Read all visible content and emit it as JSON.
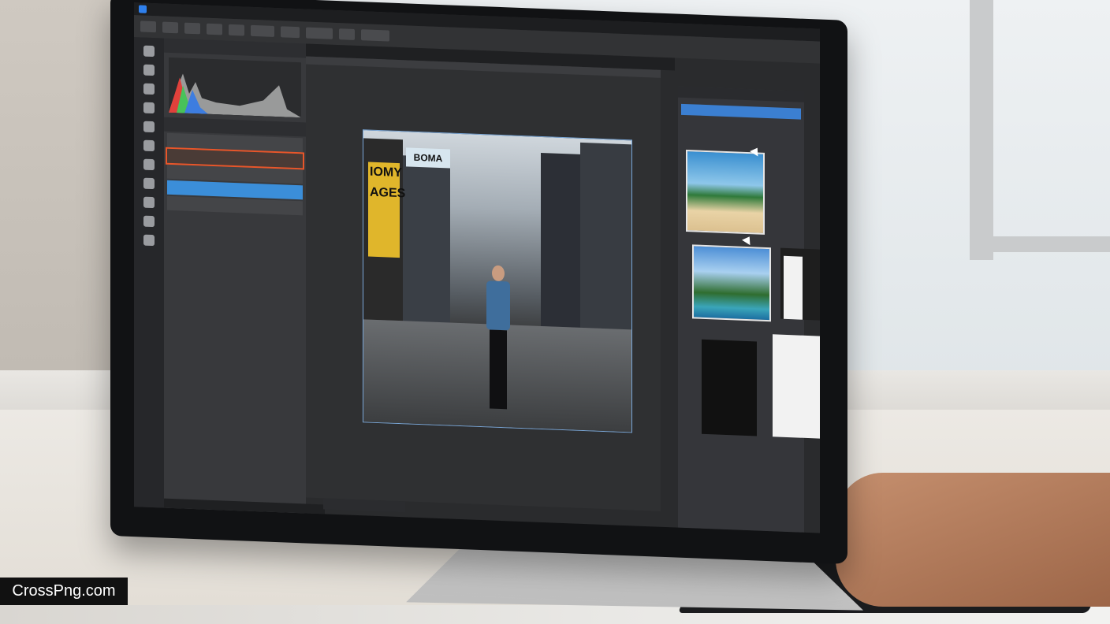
{
  "watermark": "CrossPng.com",
  "app": {
    "menu": [
      "",
      "",
      "",
      "",
      ""
    ],
    "document_tab": "",
    "panels": {
      "left_tabs": [
        "",
        ""
      ],
      "layers": [
        {
          "label": "",
          "state": "normal"
        },
        {
          "label": "",
          "state": "highlighted"
        },
        {
          "label": "",
          "state": "normal"
        },
        {
          "label": "",
          "state": "selected"
        },
        {
          "label": "",
          "state": "normal"
        }
      ],
      "right_tabs": [
        "",
        ""
      ],
      "status_left": "",
      "status_right": ""
    }
  },
  "colors": {
    "accent_blue": "#3b8ed9",
    "highlight_orange": "#e8562a",
    "ui_dark": "#2a2b2d"
  },
  "photo": {
    "signs": [
      "IOMY",
      "AGES",
      "BOMA"
    ]
  },
  "icons": [
    "app-logo-icon",
    "brush-icon",
    "lasso-icon",
    "crop-icon",
    "eyedropper-icon",
    "eraser-icon",
    "mouse-cursor-icon"
  ]
}
